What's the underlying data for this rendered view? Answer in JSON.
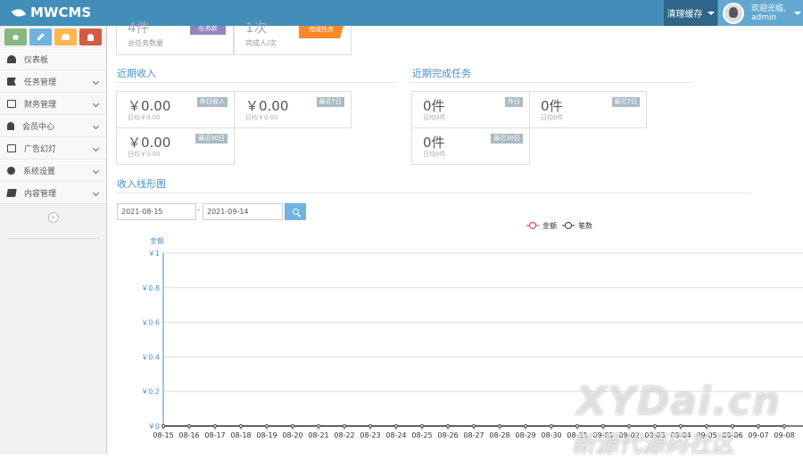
{
  "app": {
    "brand": "MWCMS"
  },
  "header": {
    "clear_cache": "清理缓存",
    "welcome": "欢迎光临,",
    "username": "admin"
  },
  "shortcuts": [
    {
      "name": "home",
      "color": "#87b87f"
    },
    {
      "name": "pencil",
      "color": "#6fb3e0"
    },
    {
      "name": "users",
      "color": "#ffb752"
    },
    {
      "name": "bell",
      "color": "#d15b47"
    }
  ],
  "sidebar": {
    "items": [
      {
        "label": "仪表板",
        "icon": "dashboard-icon"
      },
      {
        "label": "任务管理",
        "icon": "flag-icon"
      },
      {
        "label": "财务管理",
        "icon": "inbox-icon"
      },
      {
        "label": "会员中心",
        "icon": "user-icon"
      },
      {
        "label": "广告幻灯",
        "icon": "picture-icon"
      },
      {
        "label": "系统设置",
        "icon": "cog-icon"
      },
      {
        "label": "内容管理",
        "icon": "book-icon"
      }
    ],
    "collapse": "«"
  },
  "top_cards": [
    {
      "value": "4件",
      "label": "总任务数量",
      "tag": "任务数"
    },
    {
      "value": "1次",
      "label": "完成人/次",
      "tag": "完成任务"
    }
  ],
  "income": {
    "title": "近期收入",
    "cards": [
      {
        "value": "￥0.00",
        "sub": "日均￥0.00",
        "tag": "昨日收入"
      },
      {
        "value": "￥0.00",
        "sub": "日均￥0.00",
        "tag": "最近7日"
      },
      {
        "value": "￥0.00",
        "sub": "日均￥0.00",
        "tag": "最近30日"
      }
    ]
  },
  "tasks": {
    "title": "近期完成任务",
    "cards": [
      {
        "value": "0件",
        "sub": "日均0件",
        "tag": "昨日"
      },
      {
        "value": "0件",
        "sub": "日均0件",
        "tag": "最近7日"
      },
      {
        "value": "0件",
        "sub": "日均0件",
        "tag": "最近30日"
      }
    ]
  },
  "chart_section": {
    "title": "收入线形图",
    "date_from": "2021-08-15",
    "date_sep": "-",
    "date_to": "2021-09-14"
  },
  "chart_data": {
    "type": "line",
    "ylabel": "金额",
    "ylim": [
      0,
      1
    ],
    "y_ticks": [
      "￥0",
      "￥0.2",
      "￥0.4",
      "￥0.6",
      "￥0.8",
      "￥1"
    ],
    "legend": [
      "金额",
      "笔数"
    ],
    "categories": [
      "08-15",
      "08-16",
      "08-17",
      "08-18",
      "08-19",
      "08-20",
      "08-21",
      "08-22",
      "08-23",
      "08-24",
      "08-25",
      "08-26",
      "08-27",
      "08-28",
      "08-29",
      "08-30",
      "08-31",
      "09-01",
      "09-02",
      "09-03",
      "09-04",
      "09-05",
      "09-06",
      "09-07",
      "09-08"
    ],
    "series": [
      {
        "name": "金额",
        "color": "#d9534f",
        "values": [
          0,
          0,
          0,
          0,
          0,
          0,
          0,
          0,
          0,
          0,
          0,
          0,
          0,
          0,
          0,
          0,
          0,
          0,
          0,
          0,
          0,
          0,
          0,
          0,
          0
        ]
      },
      {
        "name": "笔数",
        "color": "#4b5566",
        "values": [
          0,
          0,
          0,
          0,
          0,
          0,
          0,
          0,
          0,
          0,
          0,
          0,
          0,
          0,
          0,
          0,
          0,
          0,
          0,
          0,
          0,
          0,
          0,
          0,
          0
        ]
      }
    ]
  },
  "watermark": {
    "line1": "XYDai.cn",
    "line2": "新源代源码社区"
  }
}
